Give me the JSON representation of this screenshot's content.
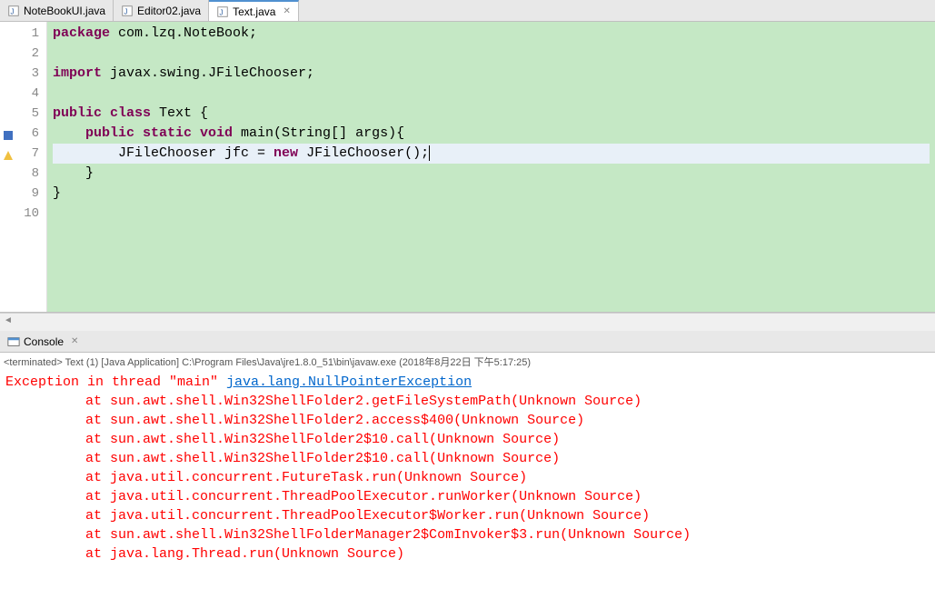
{
  "tabs": [
    {
      "label": "NoteBookUI.java",
      "active": false
    },
    {
      "label": "Editor02.java",
      "active": false
    },
    {
      "label": "Text.java",
      "active": true
    }
  ],
  "code": {
    "lines": [
      {
        "n": "1",
        "tokens": [
          {
            "t": "package ",
            "c": "kw"
          },
          {
            "t": "com.lzq.NoteBook;"
          }
        ]
      },
      {
        "n": "2",
        "tokens": []
      },
      {
        "n": "3",
        "tokens": [
          {
            "t": "import ",
            "c": "kw"
          },
          {
            "t": "javax.swing.JFileChooser;"
          }
        ]
      },
      {
        "n": "4",
        "tokens": []
      },
      {
        "n": "5",
        "tokens": [
          {
            "t": "public class ",
            "c": "kw"
          },
          {
            "t": "Text {"
          }
        ]
      },
      {
        "n": "6",
        "tokens": [
          {
            "t": "    "
          },
          {
            "t": "public static void ",
            "c": "kw"
          },
          {
            "t": "main(String[] args){"
          }
        ],
        "marker": "blue"
      },
      {
        "n": "7",
        "tokens": [
          {
            "t": "        JFileChooser jfc = "
          },
          {
            "t": "new ",
            "c": "kw"
          },
          {
            "t": "JFileChooser();"
          }
        ],
        "highlight": true,
        "marker": "warn",
        "cursor": true
      },
      {
        "n": "8",
        "tokens": [
          {
            "t": "    }"
          }
        ]
      },
      {
        "n": "9",
        "tokens": [
          {
            "t": "}"
          }
        ]
      },
      {
        "n": "10",
        "tokens": []
      }
    ]
  },
  "console": {
    "tab_label": "Console",
    "header": "<terminated> Text (1) [Java Application] C:\\Program Files\\Java\\jre1.8.0_51\\bin\\javaw.exe (2018年8月22日 下午5:17:25)",
    "exception_prefix": "Exception in thread \"main\" ",
    "exception_link": "java.lang.NullPointerException",
    "stack": [
      "at sun.awt.shell.Win32ShellFolder2.getFileSystemPath(Unknown Source)",
      "at sun.awt.shell.Win32ShellFolder2.access$400(Unknown Source)",
      "at sun.awt.shell.Win32ShellFolder2$10.call(Unknown Source)",
      "at sun.awt.shell.Win32ShellFolder2$10.call(Unknown Source)",
      "at java.util.concurrent.FutureTask.run(Unknown Source)",
      "at java.util.concurrent.ThreadPoolExecutor.runWorker(Unknown Source)",
      "at java.util.concurrent.ThreadPoolExecutor$Worker.run(Unknown Source)",
      "at sun.awt.shell.Win32ShellFolderManager2$ComInvoker$3.run(Unknown Source)",
      "at java.lang.Thread.run(Unknown Source)"
    ]
  }
}
